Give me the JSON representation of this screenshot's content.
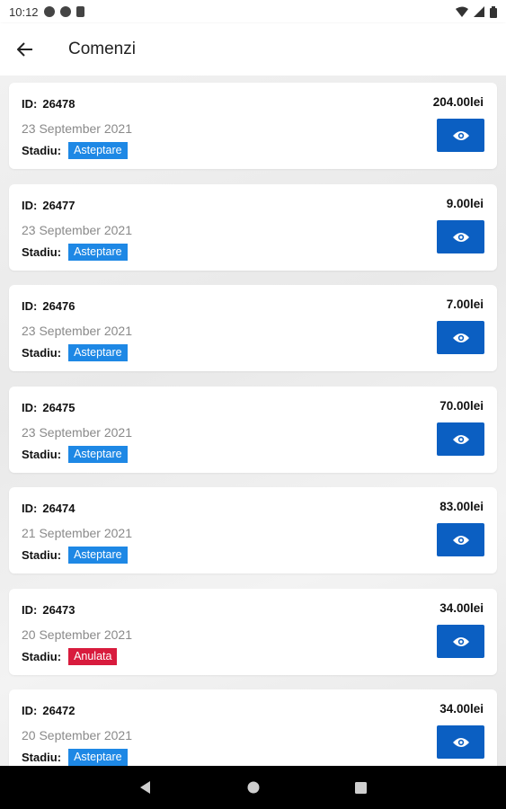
{
  "status_bar": {
    "time": "10:12"
  },
  "app_bar": {
    "title": "Comenzi"
  },
  "labels": {
    "id": "ID:",
    "stage": "Stadiu:"
  },
  "orders": [
    {
      "id": "26478",
      "date": "23 September 2021",
      "status": "Asteptare",
      "status_type": "wait",
      "price": "204.00lei"
    },
    {
      "id": "26477",
      "date": "23 September 2021",
      "status": "Asteptare",
      "status_type": "wait",
      "price": "9.00lei"
    },
    {
      "id": "26476",
      "date": "23 September 2021",
      "status": "Asteptare",
      "status_type": "wait",
      "price": "7.00lei"
    },
    {
      "id": "26475",
      "date": "23 September 2021",
      "status": "Asteptare",
      "status_type": "wait",
      "price": "70.00lei"
    },
    {
      "id": "26474",
      "date": "21 September 2021",
      "status": "Asteptare",
      "status_type": "wait",
      "price": "83.00lei"
    },
    {
      "id": "26473",
      "date": "20 September 2021",
      "status": "Anulata",
      "status_type": "cancel",
      "price": "34.00lei"
    },
    {
      "id": "26472",
      "date": "20 September 2021",
      "status": "Asteptare",
      "status_type": "wait",
      "price": "34.00lei"
    }
  ],
  "colors": {
    "view_button": "#0b5fc2",
    "badge_wait": "#1e88e5",
    "badge_cancel": "#d81b3d"
  },
  "icons": {
    "back": "arrow-left-icon",
    "view": "eye-icon"
  }
}
